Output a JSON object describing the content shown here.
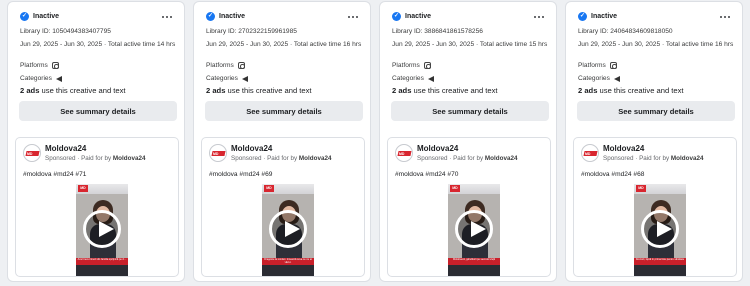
{
  "summary_label": "See summary details",
  "ads_use_suffix": "use this creative and text",
  "sponsored_label": "Sponsored",
  "paid_for_label": " · Paid for by ",
  "platforms_label": "Platforms",
  "categories_label": "Categories",
  "cards": [
    {
      "status": "Inactive",
      "library_id": "Library ID: 1050494383407795",
      "dates": "Jun 29, 2025 - Jun 30, 2025 · Total active time 14 hrs",
      "ads_count": "2 ads",
      "page_name": "Moldova24",
      "payer": "Moldova24",
      "hashtags": "#moldova #md24 #71",
      "video_caption": "Anul trecut tinerii din familia sprijiniră pe zi..."
    },
    {
      "status": "Inactive",
      "library_id": "Library ID: 2702322159961985",
      "dates": "Jun 29, 2025 - Jun 30, 2025 · Total active time 16 hrs",
      "ads_count": "2 ads",
      "page_name": "Moldova24",
      "payer": "Moldova24",
      "hashtags": "#moldova #md24 #69",
      "video_caption": "Dragoste la români. Încearcă ceva ce nu ai văzut."
    },
    {
      "status": "Inactive",
      "library_id": "Library ID: 3886841861578256",
      "dates": "Jun 29, 2025 - Jun 30, 2025 · Total active time 15 hrs",
      "ads_count": "2 ads",
      "page_name": "Moldova24",
      "payer": "Moldova24",
      "hashtags": "#moldova #md24 #70",
      "video_caption": "Moldovenii, gânditorii pe secretul vieții"
    },
    {
      "status": "Inactive",
      "library_id": "Library ID: 24064834609818050",
      "dates": "Jun 29, 2025 - Jun 30, 2025 · Total active time 16 hrs",
      "ads_count": "2 ads",
      "page_name": "Moldova24",
      "payer": "Moldova24",
      "hashtags": "#moldova #md24 #68",
      "video_caption": "Doctorii, luptă în prima linie pentru sănătate"
    }
  ],
  "colors": {
    "status_icon": "#1877f2",
    "brand_red": "#d8262f",
    "page_bg": "#eef0f3",
    "button_bg": "#e9ebee"
  },
  "icons": {
    "status": "check-circle-icon",
    "more": "more-options-icon",
    "platform": "instagram-icon",
    "category": "megaphone-icon",
    "video": "play-icon"
  }
}
